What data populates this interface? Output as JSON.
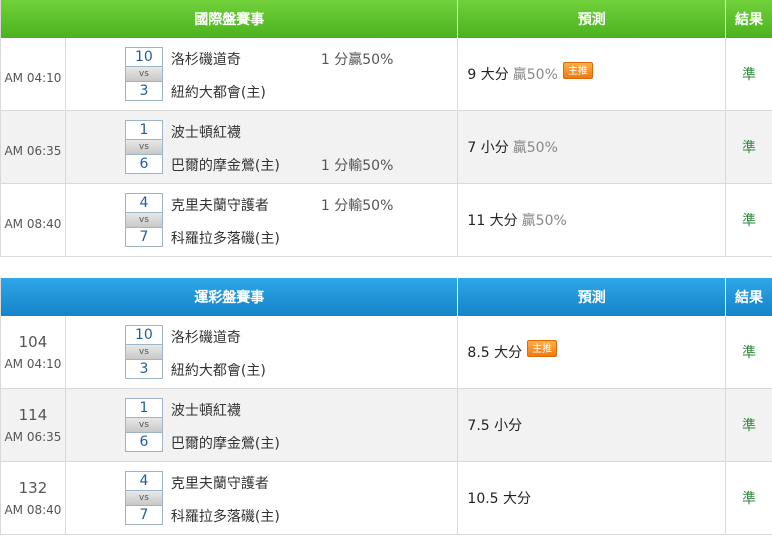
{
  "international": {
    "header": {
      "match": "國際盤賽事",
      "prediction": "預測",
      "result": "結果"
    },
    "rows": [
      {
        "time": "AM 04:10",
        "score1": "10",
        "vs": "vs",
        "score2": "3",
        "team1": "洛杉磯道奇",
        "team2": "紐約大都會(主)",
        "odds1": "1 分贏50%",
        "odds2": "",
        "pick": "9 大分",
        "rate": "贏50%",
        "badge": "主推",
        "result": "準"
      },
      {
        "time": "AM 06:35",
        "score1": "1",
        "vs": "vs",
        "score2": "6",
        "team1": "波士頓紅襪",
        "team2": "巴爾的摩金鶯(主)",
        "odds1": "",
        "odds2": "1 分輸50%",
        "pick": "7 小分",
        "rate": "贏50%",
        "badge": "",
        "result": "準"
      },
      {
        "time": "AM 08:40",
        "score1": "4",
        "vs": "vs",
        "score2": "7",
        "team1": "克里夫蘭守護者",
        "team2": "科羅拉多落磯(主)",
        "odds1": "1 分輸50%",
        "odds2": "",
        "pick": "11 大分",
        "rate": "贏50%",
        "badge": "",
        "result": "準"
      }
    ]
  },
  "lottery": {
    "header": {
      "match": "運彩盤賽事",
      "prediction": "預測",
      "result": "結果"
    },
    "rows": [
      {
        "game_no": "104",
        "time": "AM 04:10",
        "score1": "10",
        "vs": "vs",
        "score2": "3",
        "team1": "洛杉磯道奇",
        "team2": "紐約大都會(主)",
        "pick": "8.5 大分",
        "badge": "主推",
        "result": "準"
      },
      {
        "game_no": "114",
        "time": "AM 06:35",
        "score1": "1",
        "vs": "vs",
        "score2": "6",
        "team1": "波士頓紅襪",
        "team2": "巴爾的摩金鶯(主)",
        "pick": "7.5 小分",
        "badge": "",
        "result": "準"
      },
      {
        "game_no": "132",
        "time": "AM 08:40",
        "score1": "4",
        "vs": "vs",
        "score2": "7",
        "team1": "克里夫蘭守護者",
        "team2": "科羅拉多落磯(主)",
        "pick": "10.5 大分",
        "badge": "",
        "result": "準"
      }
    ]
  }
}
